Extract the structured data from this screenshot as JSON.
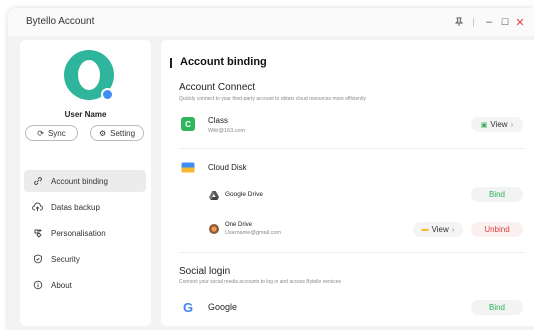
{
  "window": {
    "title": "Bytello Account"
  },
  "titlebar": {
    "pin_icon": "pin-icon",
    "minimize": "–",
    "maximize": "☐",
    "close": "✕"
  },
  "profile": {
    "user_name": "User Name",
    "sync_label": "Sync",
    "setting_label": "Setting"
  },
  "sidebar": {
    "items": [
      {
        "label": "Account binding",
        "icon": "link-icon"
      },
      {
        "label": "Datas backup",
        "icon": "cloud-upload-icon"
      },
      {
        "label": "Personalisation",
        "icon": "personalisation-icon"
      },
      {
        "label": "Security",
        "icon": "shield-icon"
      },
      {
        "label": "About",
        "icon": "info-icon"
      }
    ]
  },
  "main": {
    "title": "Account binding",
    "account_connect": {
      "title": "Account Connect",
      "subtitle": "Quickly connect to your third-party account to obtain cloud resources more efficiently"
    },
    "class": {
      "name": "Class",
      "account": "Wikl@163.com",
      "view_label": "View"
    },
    "cloud_disk": {
      "title": "Cloud Disk"
    },
    "google_drive": {
      "name": "Google Drive",
      "bind_label": "Bind"
    },
    "one_drive": {
      "name": "One Drive",
      "account": "Username@gmail.com",
      "view_label": "View",
      "unbind_label": "Unbind"
    },
    "social_login": {
      "title": "Social login",
      "subtitle": "Connect your social media accounts to log in and access Bytello services"
    },
    "google": {
      "name": "Google",
      "bind_label": "Bind"
    }
  },
  "colors": {
    "accent": "#2fb59c",
    "bind": "#2fae5c",
    "unbind": "#e0413b",
    "badge": "#3d8df5"
  }
}
